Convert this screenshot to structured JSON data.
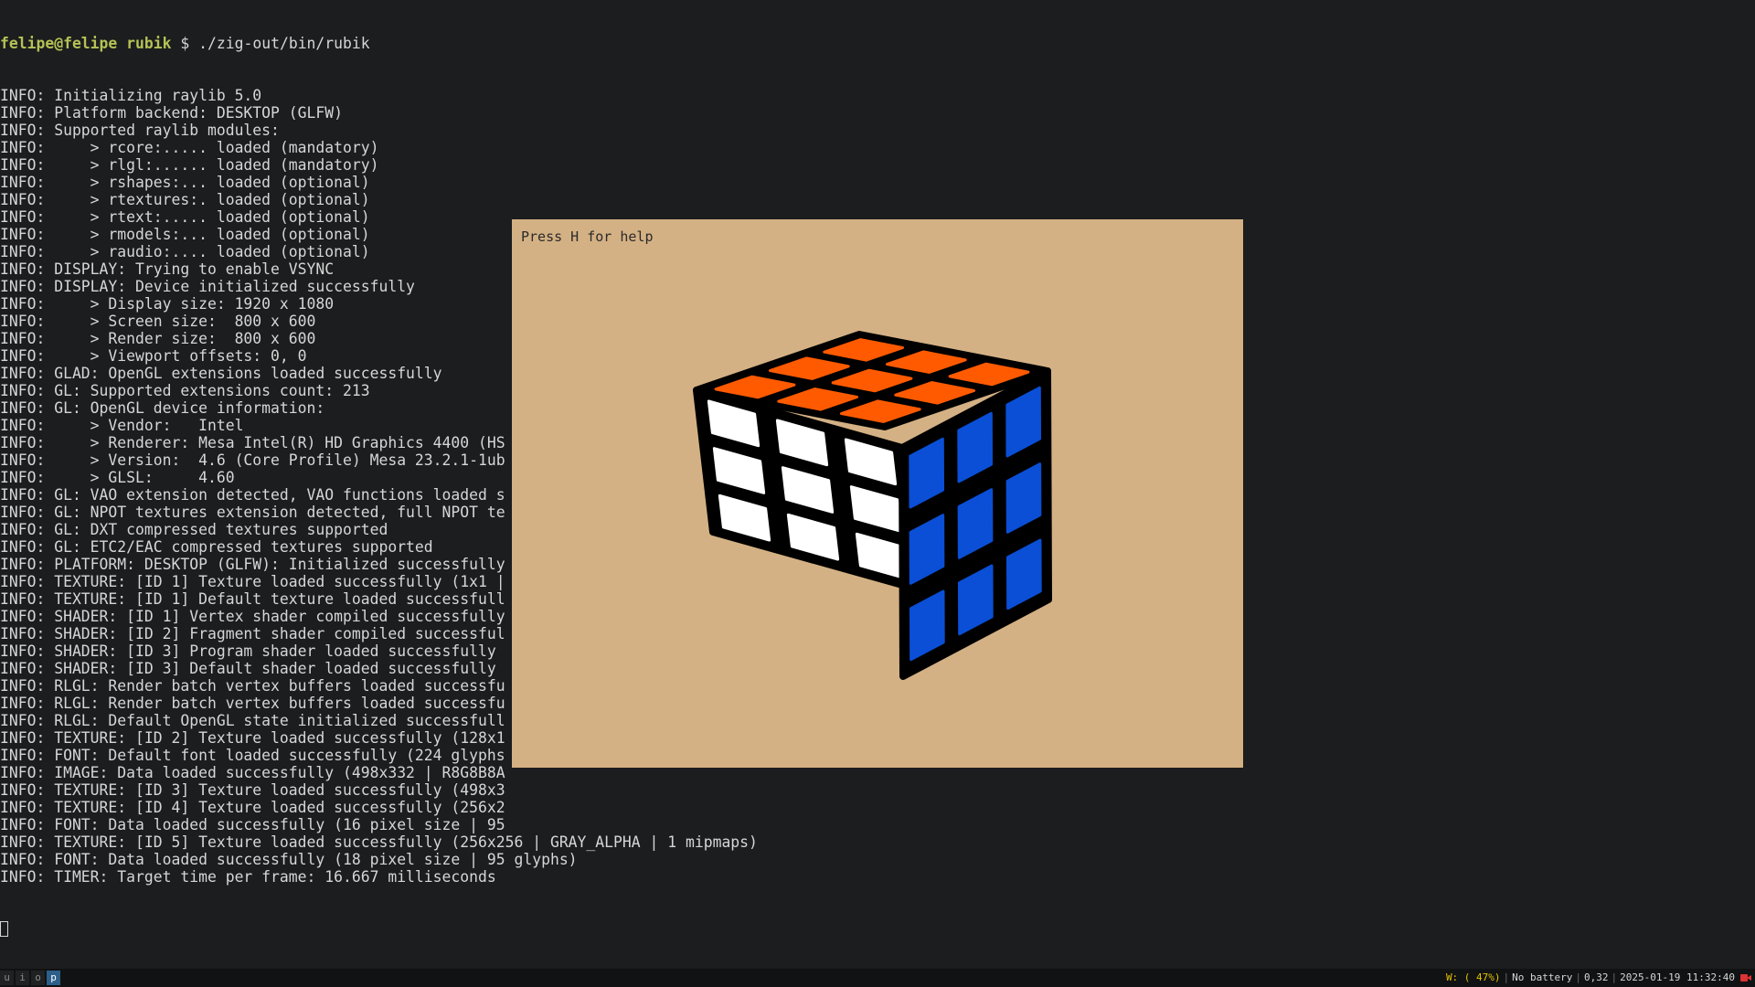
{
  "terminal": {
    "prompt": {
      "user_host": "felipe@felipe",
      "cwd": "rubik",
      "symbol": "$",
      "command": "./zig-out/bin/rubik"
    },
    "lines": [
      "INFO: Initializing raylib 5.0",
      "INFO: Platform backend: DESKTOP (GLFW)",
      "INFO: Supported raylib modules:",
      "INFO:     > rcore:..... loaded (mandatory)",
      "INFO:     > rlgl:...... loaded (mandatory)",
      "INFO:     > rshapes:... loaded (optional)",
      "INFO:     > rtextures:. loaded (optional)",
      "INFO:     > rtext:..... loaded (optional)",
      "INFO:     > rmodels:... loaded (optional)",
      "INFO:     > raudio:.... loaded (optional)",
      "INFO: DISPLAY: Trying to enable VSYNC",
      "INFO: DISPLAY: Device initialized successfully",
      "INFO:     > Display size: 1920 x 1080",
      "INFO:     > Screen size:  800 x 600",
      "INFO:     > Render size:  800 x 600",
      "INFO:     > Viewport offsets: 0, 0",
      "INFO: GLAD: OpenGL extensions loaded successfully",
      "INFO: GL: Supported extensions count: 213",
      "INFO: GL: OpenGL device information:",
      "INFO:     > Vendor:   Intel",
      "INFO:     > Renderer: Mesa Intel(R) HD Graphics 4400 (HS",
      "INFO:     > Version:  4.6 (Core Profile) Mesa 23.2.1-1ub",
      "INFO:     > GLSL:     4.60",
      "INFO: GL: VAO extension detected, VAO functions loaded s",
      "INFO: GL: NPOT textures extension detected, full NPOT te",
      "INFO: GL: DXT compressed textures supported",
      "INFO: GL: ETC2/EAC compressed textures supported",
      "INFO: PLATFORM: DESKTOP (GLFW): Initialized successfully",
      "INFO: TEXTURE: [ID 1] Texture loaded successfully (1x1 |",
      "INFO: TEXTURE: [ID 1] Default texture loaded successfull",
      "INFO: SHADER: [ID 1] Vertex shader compiled successfully",
      "INFO: SHADER: [ID 2] Fragment shader compiled successful",
      "INFO: SHADER: [ID 3] Program shader loaded successfully",
      "INFO: SHADER: [ID 3] Default shader loaded successfully",
      "INFO: RLGL: Render batch vertex buffers loaded successfu",
      "INFO: RLGL: Render batch vertex buffers loaded successfu",
      "INFO: RLGL: Default OpenGL state initialized successfull",
      "INFO: TEXTURE: [ID 2] Texture loaded successfully (128x1",
      "INFO: FONT: Default font loaded successfully (224 glyphs",
      "INFO: IMAGE: Data loaded successfully (498x332 | R8G8B8A",
      "INFO: TEXTURE: [ID 3] Texture loaded successfully (498x3",
      "INFO: TEXTURE: [ID 4] Texture loaded successfully (256x2",
      "INFO: FONT: Data loaded successfully (16 pixel size | 95",
      "INFO: TEXTURE: [ID 5] Texture loaded successfully (256x256 | GRAY_ALPHA | 1 mipmaps)",
      "INFO: FONT: Data loaded successfully (18 pixel size | 95 glyphs)",
      "INFO: TIMER: Target time per frame: 16.667 milliseconds"
    ]
  },
  "app": {
    "help_text": "Press H for help",
    "background_color": "#d4b184",
    "cube": {
      "top_face": [
        "orange",
        "orange",
        "orange",
        "orange",
        "orange",
        "orange",
        "orange",
        "orange",
        "orange"
      ],
      "front_face": [
        "white",
        "white",
        "white",
        "white",
        "white",
        "white",
        "white",
        "white",
        "white"
      ],
      "right_face": [
        "blue",
        "blue",
        "blue",
        "blue",
        "blue",
        "blue",
        "blue",
        "blue",
        "blue"
      ],
      "colors": {
        "orange": "#ff5a00",
        "white": "#ffffff",
        "blue": "#0a4fd6",
        "edge": "#000000"
      }
    }
  },
  "statusbar": {
    "workspaces": [
      {
        "label": "u",
        "active": false
      },
      {
        "label": "i",
        "active": false
      },
      {
        "label": "o",
        "active": false
      },
      {
        "label": "p",
        "active": true
      }
    ],
    "wifi": "W: ( 47%)",
    "battery": "No battery",
    "load": "0,32",
    "datetime": "2025-01-19 11:32:40",
    "recording_icon": "camera-record-icon"
  }
}
